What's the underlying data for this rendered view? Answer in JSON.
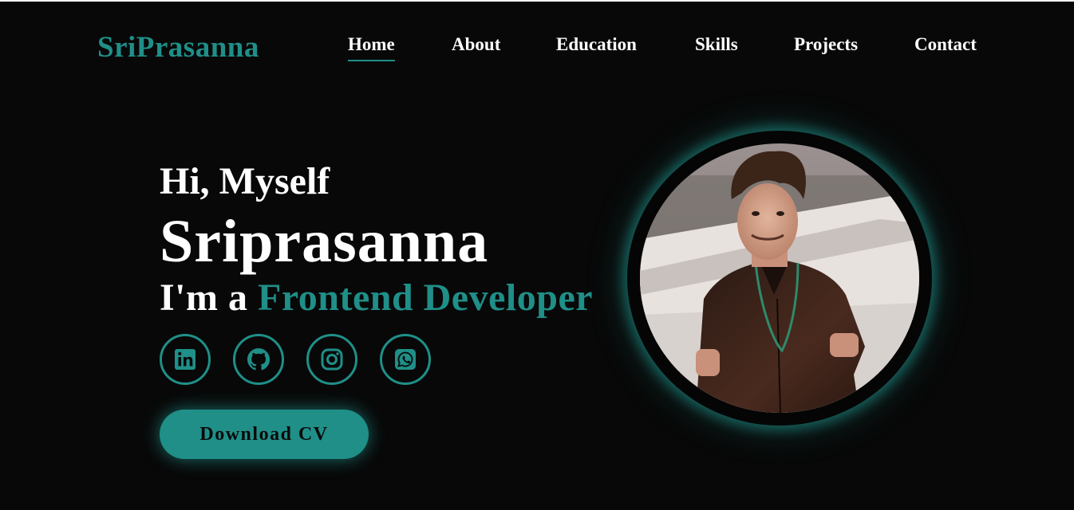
{
  "brand": {
    "logo": "SriPrasanna"
  },
  "nav": {
    "items": [
      {
        "label": "Home",
        "active": true
      },
      {
        "label": "About"
      },
      {
        "label": "Education"
      },
      {
        "label": "Skills"
      },
      {
        "label": "Projects"
      },
      {
        "label": "Contact"
      }
    ]
  },
  "hero": {
    "greeting": "Hi, Myself",
    "name": "Sriprasanna",
    "role_prefix": "I'm a ",
    "role": "Frontend Developer",
    "download_label": "Download CV"
  },
  "socials": [
    {
      "icon": "linkedin-icon"
    },
    {
      "icon": "github-icon"
    },
    {
      "icon": "instagram-icon"
    },
    {
      "icon": "whatsapp-icon"
    }
  ],
  "colors": {
    "accent": "#1f8f88",
    "background": "#080808",
    "text": "#ffffff"
  }
}
